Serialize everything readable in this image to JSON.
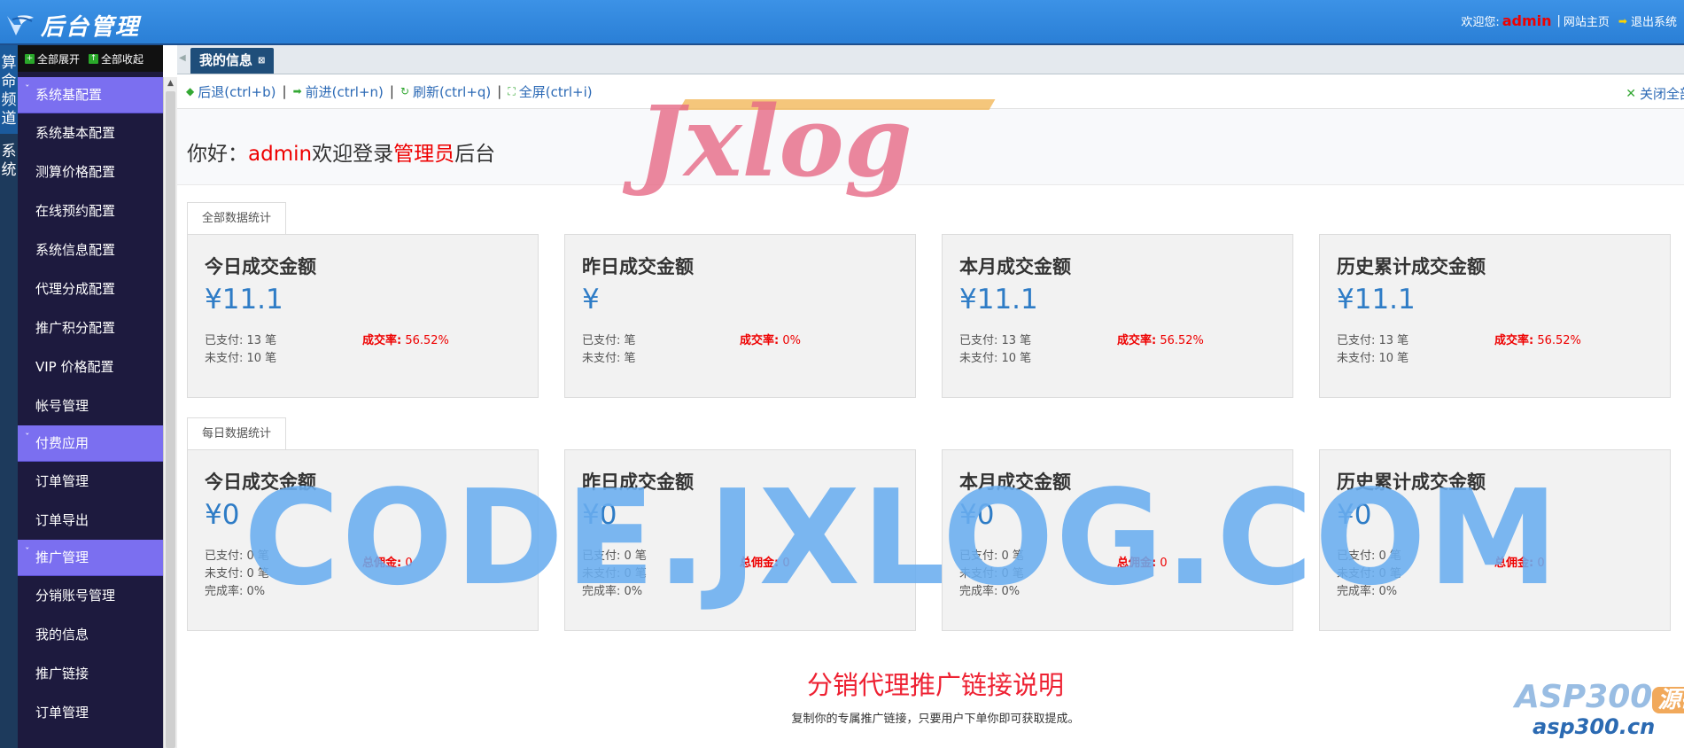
{
  "header": {
    "logo_text": "后台管理",
    "welcome_label": "欢迎您:",
    "username": "admin",
    "site_home": "网站主页",
    "logout": "退出系统"
  },
  "channels": [
    {
      "label": "算\n命\n频\n道"
    },
    {
      "label": "系\n统"
    }
  ],
  "sidebar": {
    "expand_all": "全部展开",
    "collapse_all": "全部收起",
    "groups": [
      {
        "label": "系统基配置",
        "items": [
          "系统基本配置",
          "测算价格配置",
          "在线预约配置",
          "系统信息配置",
          "代理分成配置",
          "推广积分配置",
          "VIP 价格配置",
          "帐号管理"
        ]
      },
      {
        "label": "付费应用",
        "items": [
          "订单管理",
          "订单导出"
        ]
      },
      {
        "label": "推广管理",
        "items": [
          "分销账号管理",
          "我的信息",
          "推广链接",
          "订单管理"
        ]
      }
    ]
  },
  "tabs": {
    "active": "我的信息",
    "close_symbol": "⊠"
  },
  "nav": {
    "back": "后退(ctrl+b)",
    "forward": "前进(ctrl+n)",
    "refresh": "刷新(ctrl+q)",
    "fullscreen": "全屏(ctrl+i)",
    "separator": "|",
    "close_all": "关闭全部"
  },
  "greeting": {
    "hello": "你好：",
    "user": "admin",
    "middle": "欢迎登录",
    "role": "管理员",
    "suffix": "后台"
  },
  "section_all": {
    "tab": "全部数据统计",
    "cards": [
      {
        "title": "今日成交金额",
        "amount": "¥11.1",
        "paid": "已支付: 13 笔",
        "unpaid": "未支付: 10 笔",
        "rate_label": "成交率:",
        "rate": "56.52%"
      },
      {
        "title": "昨日成交金额",
        "amount": "¥",
        "paid": "已支付: 笔",
        "unpaid": "未支付: 笔",
        "rate_label": "成交率:",
        "rate": "0%"
      },
      {
        "title": "本月成交金额",
        "amount": "¥11.1",
        "paid": "已支付: 13 笔",
        "unpaid": "未支付: 10 笔",
        "rate_label": "成交率:",
        "rate": "56.52%"
      },
      {
        "title": "历史累计成交金额",
        "amount": "¥11.1",
        "paid": "已支付: 13 笔",
        "unpaid": "未支付: 10 笔",
        "rate_label": "成交率:",
        "rate": "56.52%"
      }
    ]
  },
  "section_daily": {
    "tab": "每日数据统计",
    "cards": [
      {
        "title": "今日成交金额",
        "amount": "¥0",
        "paid": "已支付: 0 笔",
        "unpaid": "未支付: 0 笔",
        "done": "完成率: 0%",
        "commission_label": "总佣金:",
        "commission": "0"
      },
      {
        "title": "昨日成交金额",
        "amount": "¥0",
        "paid": "已支付: 0 笔",
        "unpaid": "未支付: 0 笔",
        "done": "完成率: 0%",
        "commission_label": "总佣金:",
        "commission": "0"
      },
      {
        "title": "本月成交金额",
        "amount": "¥0",
        "paid": "已支付: 0 笔",
        "unpaid": "未支付: 0 笔",
        "done": "完成率: 0%",
        "commission_label": "总佣金:",
        "commission": "0"
      },
      {
        "title": "历史累计成交金额",
        "amount": "¥0",
        "paid": "已支付: 0 笔",
        "unpaid": "未支付: 0 笔",
        "done": "完成率: 0%",
        "commission_label": "总佣金:",
        "commission": "0"
      }
    ]
  },
  "promo": {
    "title": "分销代理推广链接说明",
    "desc": "复制你的专属推广链接，只要用户下单你即可获取提成。"
  },
  "watermarks": {
    "code": "CODE.JXLOG.COM",
    "jxlog": "Jxlog",
    "asp": "ASP300",
    "asp_badge": "源码",
    "asp_url": "asp300.cn"
  }
}
